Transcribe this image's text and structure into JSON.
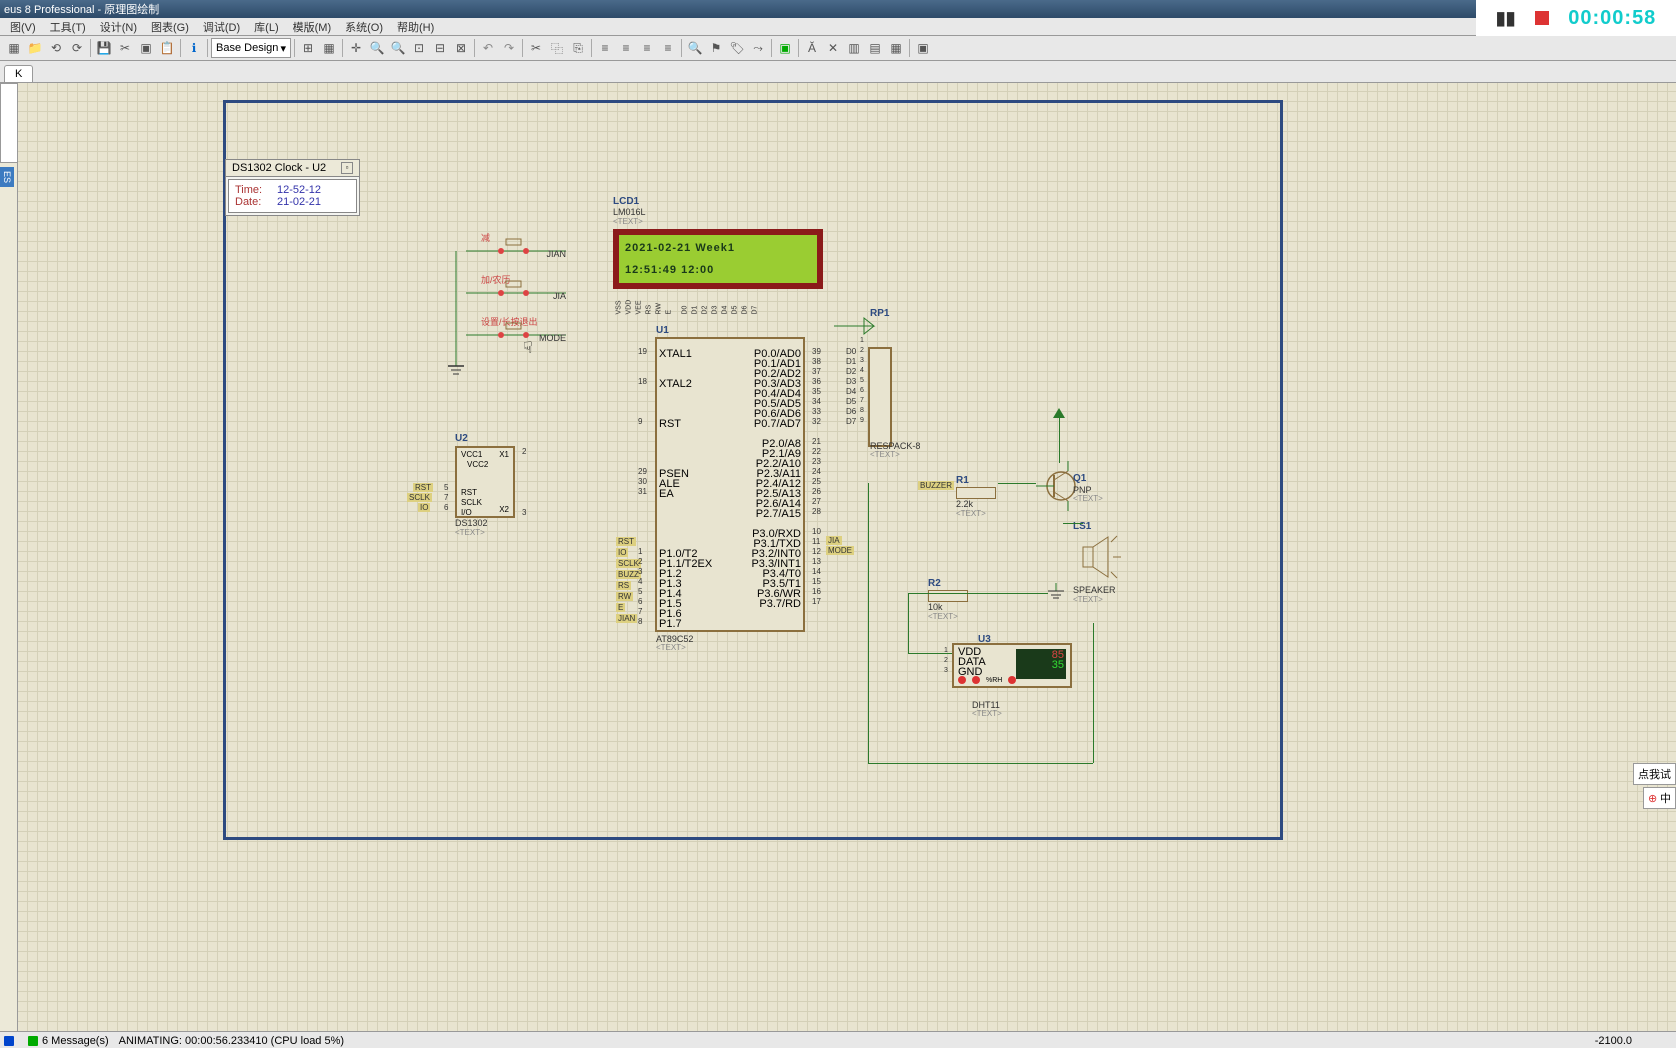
{
  "window": {
    "title": "eus 8 Professional - 原理图绘制"
  },
  "menu": {
    "items": [
      "图(V)",
      "工具(T)",
      "设计(N)",
      "图表(G)",
      "调试(D)",
      "库(L)",
      "模版(M)",
      "系统(O)",
      "帮助(H)"
    ]
  },
  "toolbar": {
    "combo": "Base Design"
  },
  "tab": {
    "label": "K"
  },
  "sidebar": {
    "label": "ES"
  },
  "ds_popup": {
    "title": "DS1302 Clock - U2",
    "time_k": "Time:",
    "time_v": "12-52-12",
    "date_k": "Date:",
    "date_v": "21-02-21"
  },
  "lcd": {
    "ref": "LCD1",
    "part": "LM016L",
    "text": "<TEXT>",
    "line1": "2021-02-21 Week1",
    "line2": "12:51:49  12:00",
    "pins": [
      "VSS",
      "VDD",
      "VEE",
      "RS",
      "RW",
      "E",
      "D0",
      "D1",
      "D2",
      "D3",
      "D4",
      "D5",
      "D6",
      "D7"
    ]
  },
  "buttons": {
    "b1": {
      "lbl": "减",
      "net": "JIAN"
    },
    "b2": {
      "lbl": "加/农历",
      "net": "JIA"
    },
    "b3": {
      "lbl": "设置/长按退出",
      "net": "MODE"
    }
  },
  "u2": {
    "ref": "U2",
    "part": "DS1302",
    "text": "<TEXT>",
    "left_nets": [
      "RST",
      "SCLK",
      "IO"
    ],
    "left_nums": [
      "5",
      "7",
      "6"
    ],
    "left_pins": [
      "RST",
      "SCLK",
      "I/O"
    ],
    "top_pins": [
      "VCC1",
      "VCC2"
    ],
    "right_pins": [
      "X1",
      "",
      "X2"
    ],
    "right_nums": [
      "2",
      "",
      "3"
    ]
  },
  "u1": {
    "ref": "U1",
    "part": "AT89C52",
    "text": "<TEXT>",
    "left": [
      {
        "n": "19",
        "p": "XTAL1"
      },
      {
        "n": "",
        "p": ""
      },
      {
        "n": "",
        "p": ""
      },
      {
        "n": "18",
        "p": "XTAL2"
      },
      {
        "n": "",
        "p": ""
      },
      {
        "n": "",
        "p": ""
      },
      {
        "n": "",
        "p": ""
      },
      {
        "n": "9",
        "p": "RST"
      },
      {
        "n": "",
        "p": ""
      },
      {
        "n": "",
        "p": ""
      },
      {
        "n": "",
        "p": ""
      },
      {
        "n": "",
        "p": ""
      },
      {
        "n": "29",
        "p": "PSEN"
      },
      {
        "n": "30",
        "p": "ALE"
      },
      {
        "n": "31",
        "p": "EA"
      },
      {
        "n": "",
        "p": ""
      },
      {
        "n": "",
        "p": ""
      },
      {
        "n": "",
        "p": ""
      },
      {
        "n": "",
        "p": ""
      },
      {
        "n": "",
        "p": ""
      },
      {
        "n": "1",
        "p": "P1.0/T2"
      },
      {
        "n": "2",
        "p": "P1.1/T2EX"
      },
      {
        "n": "3",
        "p": "P1.2"
      },
      {
        "n": "4",
        "p": "P1.3"
      },
      {
        "n": "5",
        "p": "P1.4"
      },
      {
        "n": "6",
        "p": "P1.5"
      },
      {
        "n": "7",
        "p": "P1.6"
      },
      {
        "n": "8",
        "p": "P1.7"
      }
    ],
    "right": [
      {
        "n": "39",
        "p": "P0.0/AD0"
      },
      {
        "n": "38",
        "p": "P0.1/AD1"
      },
      {
        "n": "37",
        "p": "P0.2/AD2"
      },
      {
        "n": "36",
        "p": "P0.3/AD3"
      },
      {
        "n": "35",
        "p": "P0.4/AD4"
      },
      {
        "n": "34",
        "p": "P0.5/AD5"
      },
      {
        "n": "33",
        "p": "P0.6/AD6"
      },
      {
        "n": "32",
        "p": "P0.7/AD7"
      },
      {
        "n": "",
        "p": ""
      },
      {
        "n": "21",
        "p": "P2.0/A8"
      },
      {
        "n": "22",
        "p": "P2.1/A9"
      },
      {
        "n": "23",
        "p": "P2.2/A10"
      },
      {
        "n": "24",
        "p": "P2.3/A11"
      },
      {
        "n": "25",
        "p": "P2.4/A12"
      },
      {
        "n": "26",
        "p": "P2.5/A13"
      },
      {
        "n": "27",
        "p": "P2.6/A14"
      },
      {
        "n": "28",
        "p": "P2.7/A15"
      },
      {
        "n": "",
        "p": ""
      },
      {
        "n": "10",
        "p": "P3.0/RXD"
      },
      {
        "n": "11",
        "p": "P3.1/TXD"
      },
      {
        "n": "12",
        "p": "P3.2/INT0"
      },
      {
        "n": "13",
        "p": "P3.3/INT1"
      },
      {
        "n": "14",
        "p": "P3.4/T0"
      },
      {
        "n": "15",
        "p": "P3.5/T1"
      },
      {
        "n": "16",
        "p": "P3.6/WR"
      },
      {
        "n": "17",
        "p": "P3.7/RD"
      }
    ],
    "p1_nets": [
      "RST",
      "IO",
      "SCLK",
      "BUZZ",
      "RS",
      "RW",
      "E",
      "JIAN"
    ],
    "p3_nets": [
      "JIA",
      "MODE"
    ]
  },
  "rp1": {
    "ref": "RP1",
    "part": "RESPACK-8",
    "text": "<TEXT>",
    "nums": [
      "1",
      "2",
      "3",
      "4",
      "5",
      "6",
      "7",
      "8",
      "9"
    ],
    "nets": [
      "D0",
      "D1",
      "D2",
      "D3",
      "D4",
      "D5",
      "D6",
      "D7"
    ]
  },
  "r1": {
    "ref": "R1",
    "val": "2.2k",
    "text": "<TEXT>"
  },
  "r2": {
    "ref": "R2",
    "val": "10k",
    "text": "<TEXT>"
  },
  "q1": {
    "ref": "Q1",
    "part": "PNP",
    "text": "<TEXT>"
  },
  "ls1": {
    "ref": "LS1",
    "part": "SPEAKER",
    "text": "<TEXT>"
  },
  "u3": {
    "ref": "U3",
    "part": "DHT11",
    "text": "<TEXT>",
    "pins": [
      "VDD",
      "DATA",
      "GND"
    ],
    "nums": [
      "1",
      "2",
      "3"
    ],
    "disp_t": "85",
    "disp_h": "35",
    "rh": "%RH"
  },
  "buzz_net": "BUZZER",
  "status": {
    "msgs": "6 Message(s)",
    "anim": "ANIMATING: 00:00:56.233410 (CPU load 5%)",
    "coord": "-2100.0"
  },
  "timer": {
    "time": "00:00:58"
  },
  "side_float": {
    "t1": "点我试",
    "t2": "中"
  }
}
